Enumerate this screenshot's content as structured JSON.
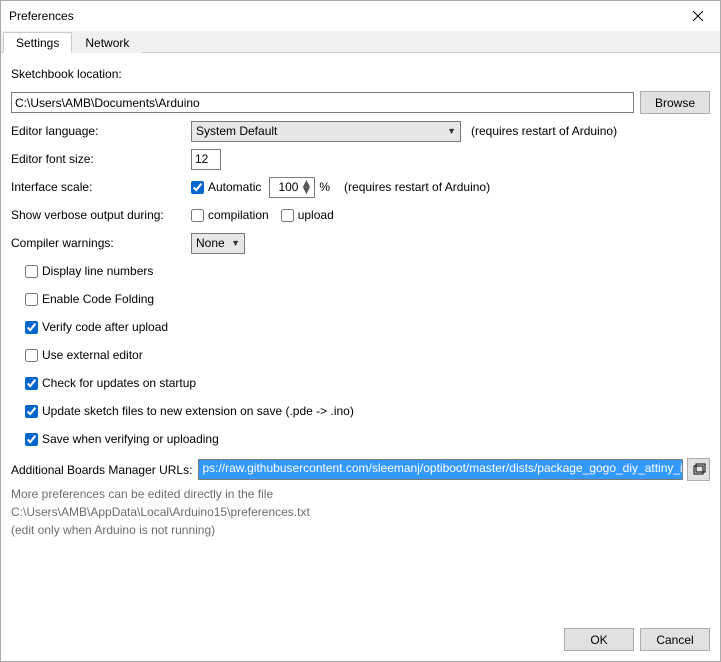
{
  "window": {
    "title": "Preferences"
  },
  "tabs": {
    "settings": "Settings",
    "network": "Network"
  },
  "labels": {
    "sketchbook": "Sketchbook location:",
    "browse": "Browse",
    "editor_lang": "Editor language:",
    "restart_hint": "(requires restart of Arduino)",
    "font_size": "Editor font size:",
    "iface_scale": "Interface scale:",
    "automatic": "Automatic",
    "percent": "%",
    "verbose": "Show verbose output during:",
    "compilation": "compilation",
    "upload": "upload",
    "compiler_warn": "Compiler warnings:",
    "line_numbers": "Display line numbers",
    "code_folding": "Enable Code Folding",
    "verify_upload": "Verify code after upload",
    "external_editor": "Use external editor",
    "check_updates": "Check for updates on startup",
    "update_ext": "Update sketch files to new extension on save (.pde -> .ino)",
    "save_verify": "Save when verifying or uploading",
    "boards_urls": "Additional Boards Manager URLs:",
    "more_prefs": "More preferences can be edited directly in the file",
    "edit_hint": "(edit only when Arduino is not running)",
    "ok": "OK",
    "cancel": "Cancel"
  },
  "values": {
    "sketchbook_path": "C:\\Users\\AMB\\Documents\\Arduino",
    "language": "System Default",
    "font_size": "12",
    "scale": "100",
    "compiler_warnings": "None",
    "boards_url": "ps://raw.githubusercontent.com/sleemanj/optiboot/master/dists/package_gogo_diy_attiny_index.json",
    "prefs_path": "C:\\Users\\AMB\\AppData\\Local\\Arduino15\\preferences.txt"
  },
  "checked": {
    "automatic": true,
    "compilation": false,
    "upload": false,
    "line_numbers": false,
    "code_folding": false,
    "verify_upload": true,
    "external_editor": false,
    "check_updates": true,
    "update_ext": true,
    "save_verify": true
  }
}
